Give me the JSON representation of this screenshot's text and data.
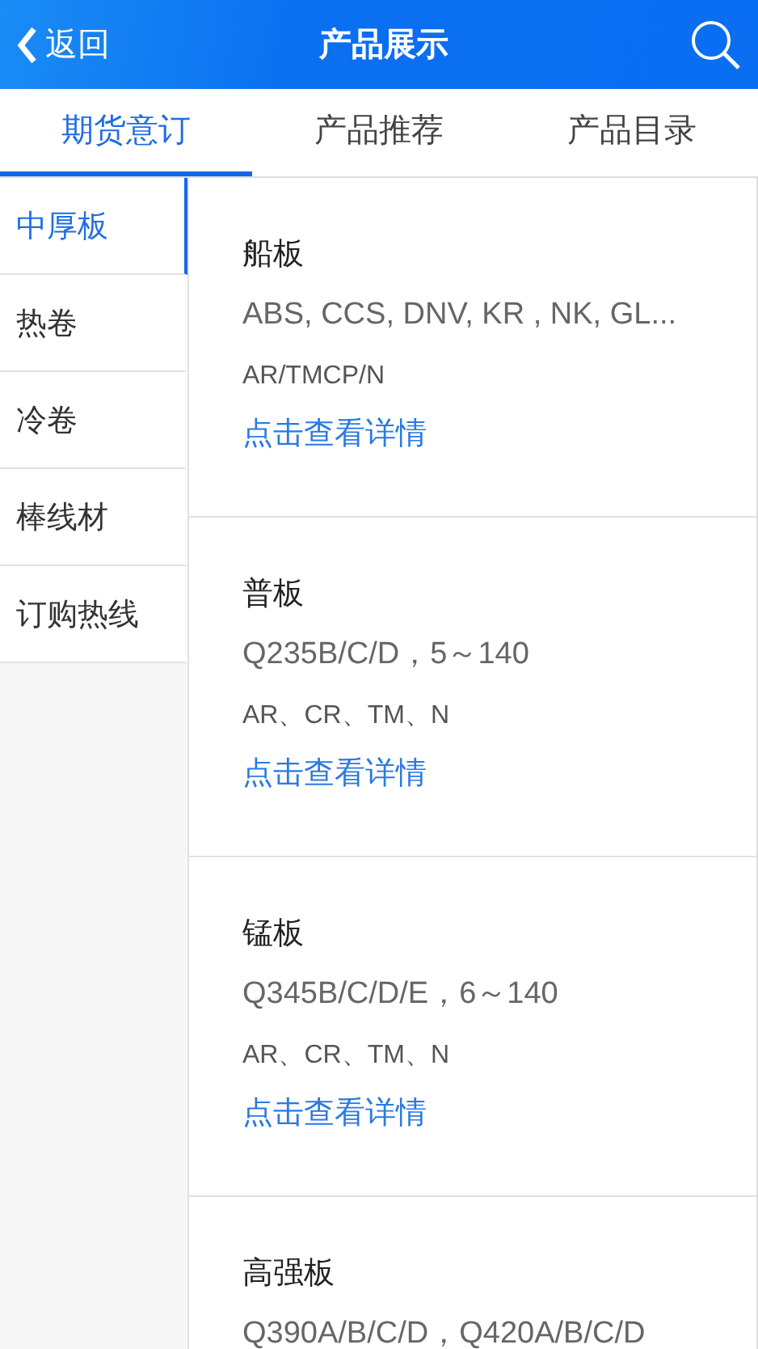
{
  "header": {
    "back_label": "返回",
    "title": "产品展示"
  },
  "tabs": [
    {
      "label": "期货意订",
      "selected": true
    },
    {
      "label": "产品推荐",
      "selected": false
    },
    {
      "label": "产品目录",
      "selected": false
    }
  ],
  "sidebar": {
    "items": [
      {
        "label": "中厚板",
        "selected": true
      },
      {
        "label": "热卷",
        "selected": false
      },
      {
        "label": "冷卷",
        "selected": false
      },
      {
        "label": "棒线材",
        "selected": false
      },
      {
        "label": "订购热线",
        "selected": false
      }
    ]
  },
  "products": [
    {
      "name": "船板",
      "spec": "ABS, CCS, DNV, KR , NK, GL...",
      "process": "AR/TMCP/N",
      "link": "点击查看详情"
    },
    {
      "name": "普板",
      "spec": "Q235B/C/D，5～140",
      "process": "AR、CR、TM、N",
      "link": "点击查看详情"
    },
    {
      "name": "锰板",
      "spec": "Q345B/C/D/E，6～140",
      "process": "AR、CR、TM、N",
      "link": "点击查看详情"
    },
    {
      "name": "高强板",
      "spec": "Q390A/B/C/D，Q420A/B/C/D"
    }
  ]
}
